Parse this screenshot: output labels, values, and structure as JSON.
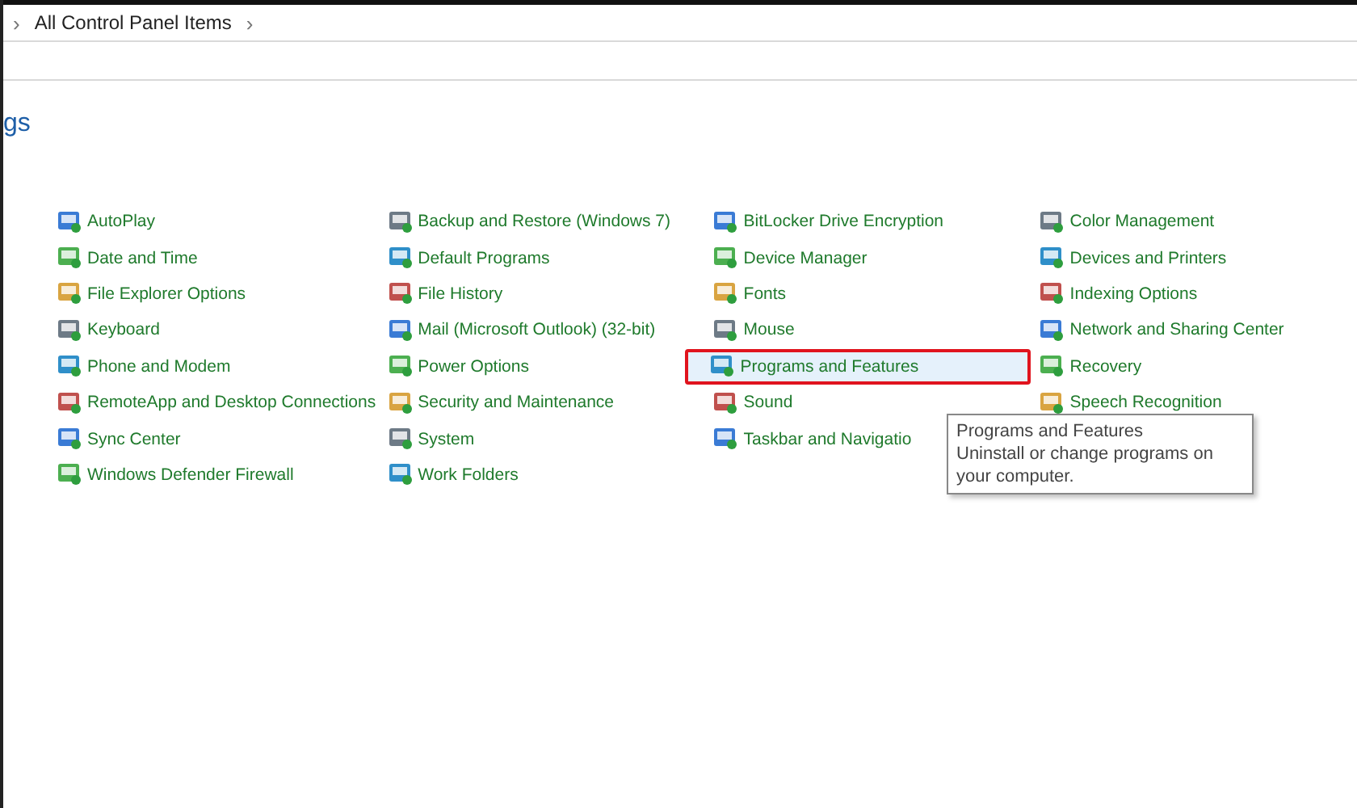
{
  "breadcrumb": {
    "separator_left": "›",
    "current": "All Control Panel Items",
    "separator_right": "›"
  },
  "heading": "gs",
  "columns": [
    {
      "items": [
        {
          "label": "AutoPlay",
          "hovered": false
        },
        {
          "label": "Date and Time",
          "hovered": false
        },
        {
          "label": "File Explorer Options",
          "hovered": false
        },
        {
          "label": "Keyboard",
          "hovered": false
        },
        {
          "label": "Phone and Modem",
          "hovered": false
        },
        {
          "label": "RemoteApp and Desktop Connections",
          "hovered": false
        },
        {
          "label": "Sync Center",
          "hovered": false
        },
        {
          "label": "Windows Defender Firewall",
          "hovered": false
        }
      ]
    },
    {
      "items": [
        {
          "label": "Backup and Restore (Windows 7)",
          "hovered": false
        },
        {
          "label": "Default Programs",
          "hovered": false
        },
        {
          "label": "File History",
          "hovered": false
        },
        {
          "label": "Mail (Microsoft Outlook) (32-bit)",
          "hovered": false
        },
        {
          "label": "Power Options",
          "hovered": false
        },
        {
          "label": "Security and Maintenance",
          "hovered": false
        },
        {
          "label": "System",
          "hovered": false
        },
        {
          "label": "Work Folders",
          "hovered": false
        }
      ]
    },
    {
      "items": [
        {
          "label": "BitLocker Drive Encryption",
          "hovered": false
        },
        {
          "label": "Device Manager",
          "hovered": false
        },
        {
          "label": "Fonts",
          "hovered": false
        },
        {
          "label": "Mouse",
          "hovered": false
        },
        {
          "label": "Programs and Features",
          "hovered": true
        },
        {
          "label": "Sound",
          "hovered": false
        },
        {
          "label": "Taskbar and Navigatio",
          "hovered": false
        }
      ]
    },
    {
      "items": [
        {
          "label": "Color Management",
          "hovered": false
        },
        {
          "label": "Devices and Printers",
          "hovered": false
        },
        {
          "label": "Indexing Options",
          "hovered": false
        },
        {
          "label": "Network and Sharing Center",
          "hovered": false
        },
        {
          "label": "Recovery",
          "hovered": false
        },
        {
          "label": "Speech Recognition",
          "hovered": false
        }
      ]
    }
  ],
  "tooltip": {
    "title": "Programs and Features",
    "description": "Uninstall or change programs on your computer."
  }
}
